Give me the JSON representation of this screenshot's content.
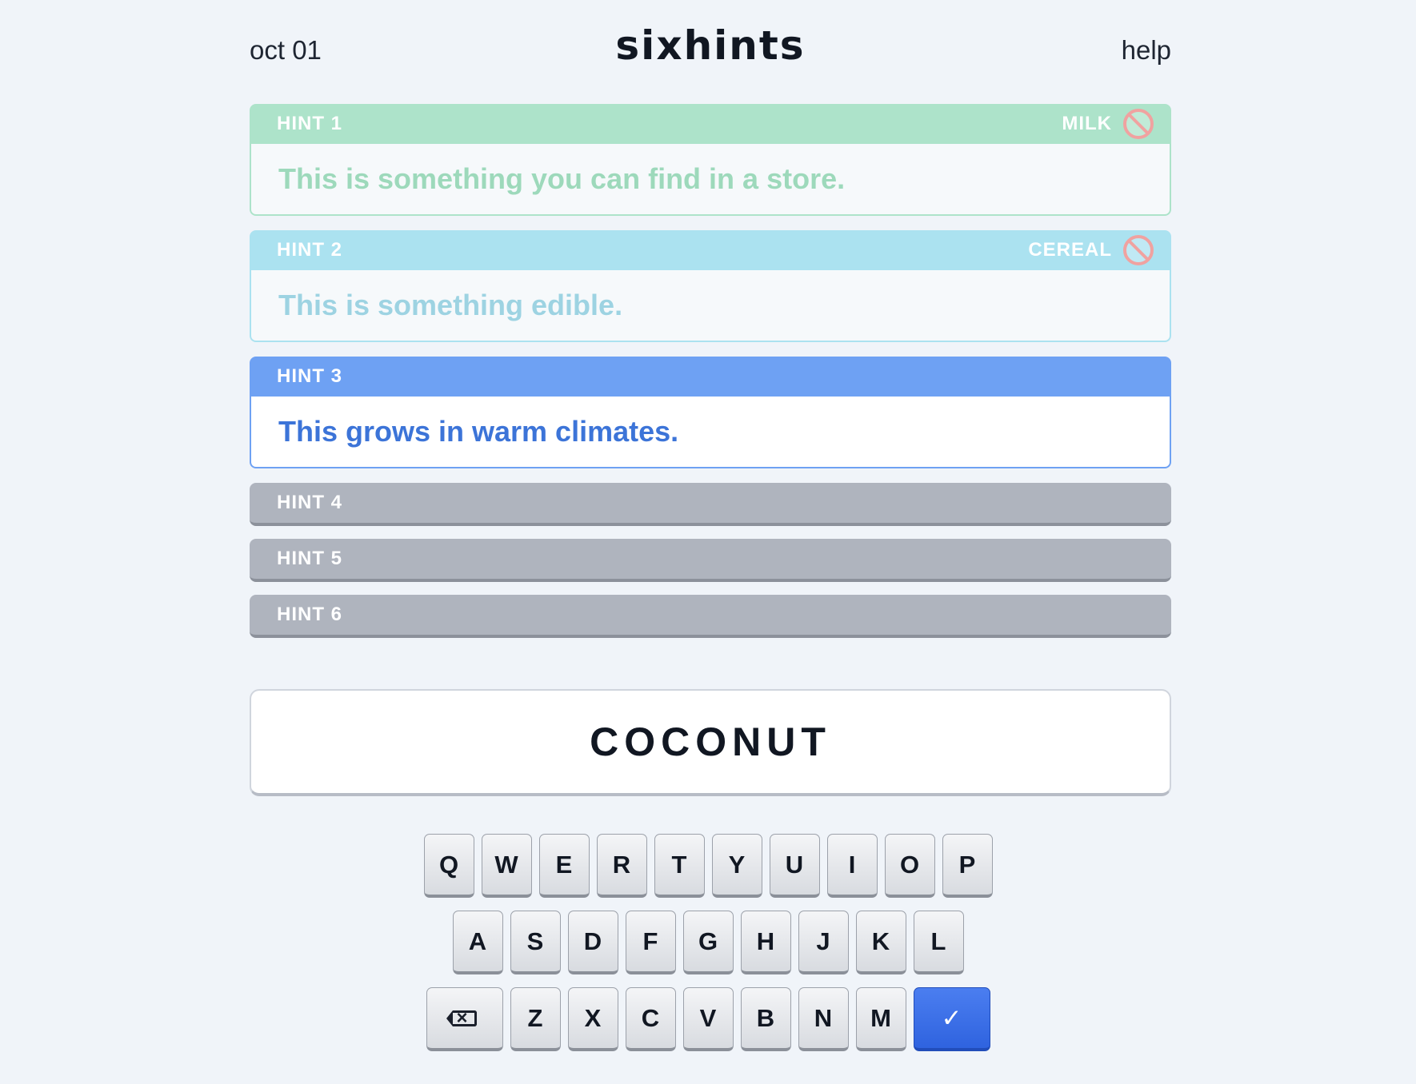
{
  "header": {
    "date": "oct 01",
    "logo": "sixhints",
    "help_label": "help"
  },
  "hints": [
    {
      "label": "HINT 1",
      "text": "This is something you can find in a store.",
      "guess": "MILK",
      "guess_icon": "no-entry-icon",
      "state": "wrong",
      "color": "#ade3ca"
    },
    {
      "label": "HINT 2",
      "text": "This is something edible.",
      "guess": "CEREAL",
      "guess_icon": "no-entry-icon",
      "state": "wrong",
      "color": "#abe2f0"
    },
    {
      "label": "HINT 3",
      "text": "This grows in warm climates.",
      "guess": "",
      "state": "active",
      "color": "#6ea1f3"
    },
    {
      "label": "HINT 4",
      "state": "locked"
    },
    {
      "label": "HINT 5",
      "state": "locked"
    },
    {
      "label": "HINT 6",
      "state": "locked"
    }
  ],
  "answer": {
    "value": "COCONUT"
  },
  "keyboard": {
    "row1": [
      "Q",
      "W",
      "E",
      "R",
      "T",
      "Y",
      "U",
      "I",
      "O",
      "P"
    ],
    "row2": [
      "A",
      "S",
      "D",
      "F",
      "G",
      "H",
      "J",
      "K",
      "L"
    ],
    "row3": [
      "Z",
      "X",
      "C",
      "V",
      "B",
      "N",
      "M"
    ],
    "backspace_icon": "backspace-icon",
    "enter_label": "✓",
    "enter_color": "#3568e2"
  }
}
